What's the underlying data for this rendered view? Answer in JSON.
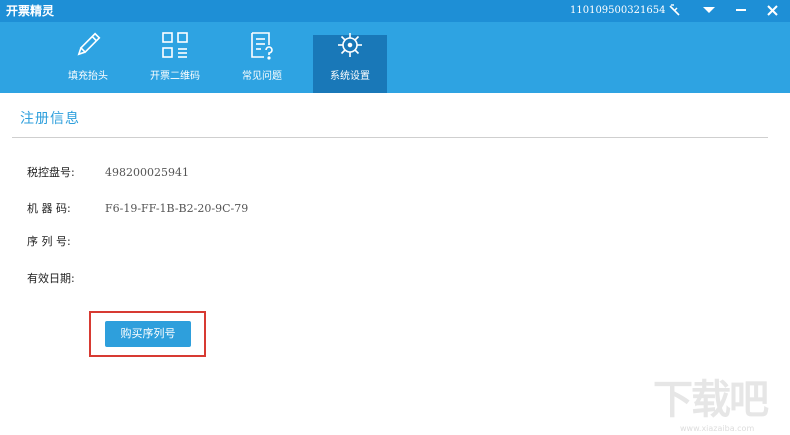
{
  "app": {
    "title": "开票精灵",
    "serial": "110109500321654"
  },
  "window_controls": {
    "signal_icon": "signal-icon",
    "menu_icon": "dropdown-icon",
    "minimize_icon": "minimize-icon",
    "close_icon": "close-icon"
  },
  "toolbar": {
    "items": [
      {
        "label": "填充抬头",
        "icon": "pencil-icon"
      },
      {
        "label": "开票二维码",
        "icon": "qr-code-icon"
      },
      {
        "label": "常见问题",
        "icon": "faq-document-icon"
      },
      {
        "label": "系统设置",
        "icon": "settings-gear-icon",
        "active": true
      }
    ]
  },
  "section": {
    "title": "注册信息"
  },
  "fields": {
    "tax_disk_label": "税控盘号:",
    "tax_disk_value": "498200025941",
    "machine_code_label": "机 器 码:",
    "machine_code_value": "F6-19-FF-1B-B2-20-9C-79",
    "serial_label": "序 列 号:",
    "serial_value": "",
    "valid_date_label": "有效日期:",
    "valid_date_value": ""
  },
  "buy_button": {
    "label": "购买序列号"
  },
  "watermark": {
    "logo": "下载吧",
    "url": "www.xiazaiba.com"
  },
  "colors": {
    "titlebar": "#1e8fd6",
    "toolbar": "#2ea3e2",
    "toolbar_active": "#1978b8",
    "accent": "#2e9fdc",
    "highlight": "#d73a32"
  }
}
